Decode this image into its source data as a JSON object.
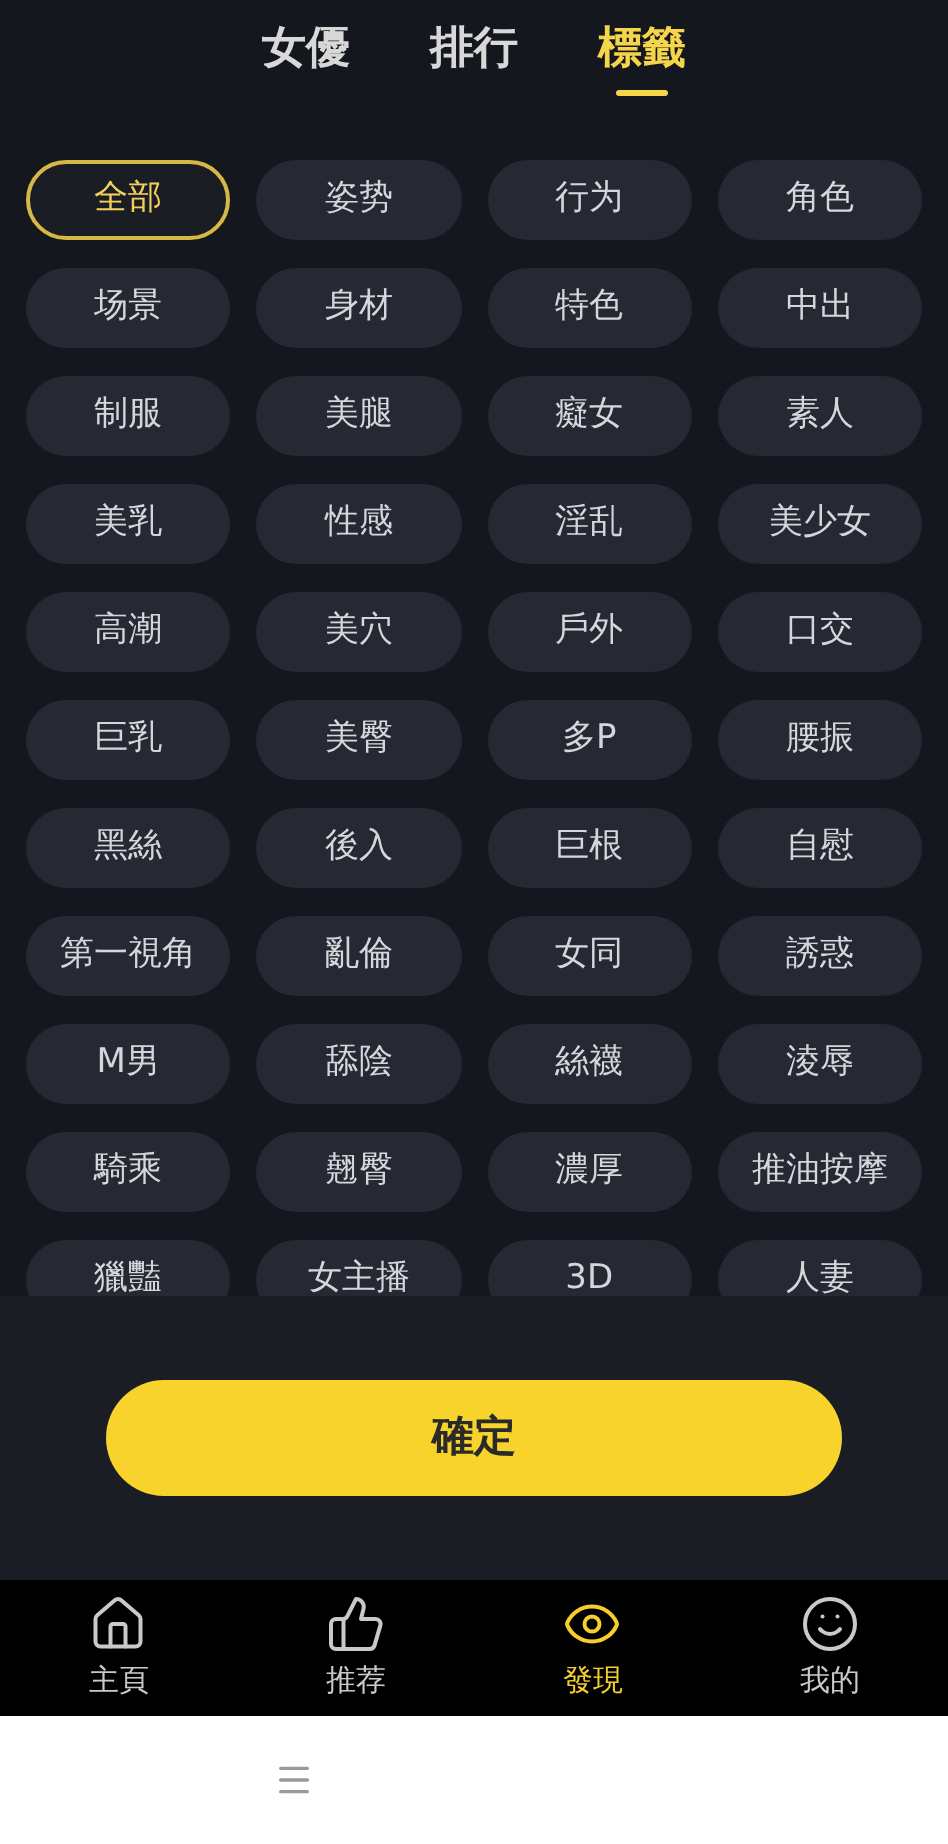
{
  "header_tabs": [
    {
      "label": "女優",
      "selected": false
    },
    {
      "label": "排行",
      "selected": false
    },
    {
      "label": "標籤",
      "selected": true
    }
  ],
  "tags": [
    {
      "label": "全部",
      "selected": true
    },
    {
      "label": "姿势",
      "selected": false
    },
    {
      "label": "行为",
      "selected": false
    },
    {
      "label": "角色",
      "selected": false
    },
    {
      "label": "场景",
      "selected": false
    },
    {
      "label": "身材",
      "selected": false
    },
    {
      "label": "特色",
      "selected": false
    },
    {
      "label": "中出",
      "selected": false
    },
    {
      "label": "制服",
      "selected": false
    },
    {
      "label": "美腿",
      "selected": false
    },
    {
      "label": "癡女",
      "selected": false
    },
    {
      "label": "素人",
      "selected": false
    },
    {
      "label": "美乳",
      "selected": false
    },
    {
      "label": "性感",
      "selected": false
    },
    {
      "label": "淫乱",
      "selected": false
    },
    {
      "label": "美少女",
      "selected": false
    },
    {
      "label": "高潮",
      "selected": false
    },
    {
      "label": "美穴",
      "selected": false
    },
    {
      "label": "戶外",
      "selected": false
    },
    {
      "label": "口交",
      "selected": false
    },
    {
      "label": "巨乳",
      "selected": false
    },
    {
      "label": "美臀",
      "selected": false
    },
    {
      "label": "多P",
      "selected": false
    },
    {
      "label": "腰振",
      "selected": false
    },
    {
      "label": "黑絲",
      "selected": false
    },
    {
      "label": "後入",
      "selected": false
    },
    {
      "label": "巨根",
      "selected": false
    },
    {
      "label": "自慰",
      "selected": false
    },
    {
      "label": "第一視角",
      "selected": false
    },
    {
      "label": "亂倫",
      "selected": false
    },
    {
      "label": "女同",
      "selected": false
    },
    {
      "label": "誘惑",
      "selected": false
    },
    {
      "label": "M男",
      "selected": false
    },
    {
      "label": "舔陰",
      "selected": false
    },
    {
      "label": "絲襪",
      "selected": false
    },
    {
      "label": "淩辱",
      "selected": false
    },
    {
      "label": "騎乘",
      "selected": false
    },
    {
      "label": "翹臀",
      "selected": false
    },
    {
      "label": "濃厚",
      "selected": false
    },
    {
      "label": "推油按摩",
      "selected": false
    },
    {
      "label": "獵豔",
      "selected": false
    },
    {
      "label": "女主播",
      "selected": false
    },
    {
      "label": "3D",
      "selected": false
    },
    {
      "label": "人妻",
      "selected": false
    }
  ],
  "confirm_button": "確定",
  "bottom_nav": [
    {
      "label": "主頁",
      "kind": "home",
      "selected": false
    },
    {
      "label": "推荐",
      "kind": "like",
      "selected": false
    },
    {
      "label": "發現",
      "kind": "discover",
      "selected": true
    },
    {
      "label": "我的",
      "kind": "profile",
      "selected": false
    }
  ]
}
